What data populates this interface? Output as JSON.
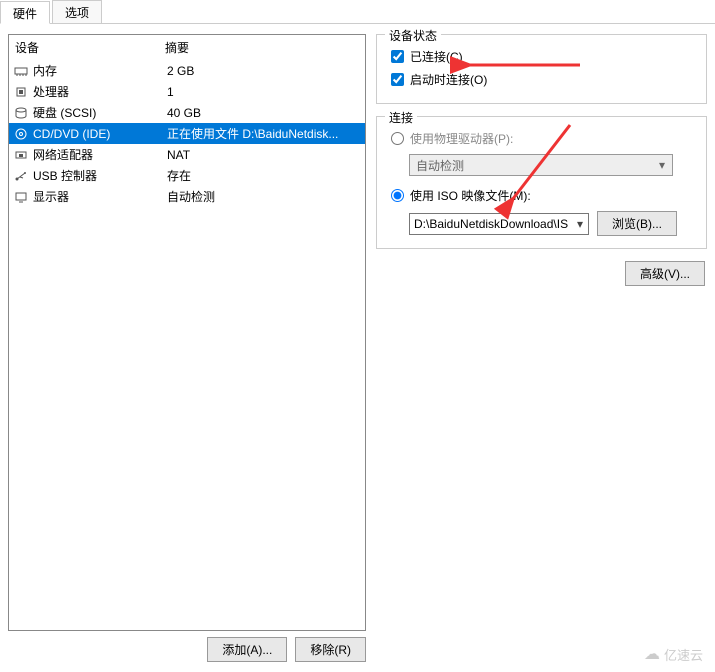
{
  "tabs": {
    "hardware": "硬件",
    "options": "选项"
  },
  "headers": {
    "device": "设备",
    "summary": "摘要"
  },
  "devices": [
    {
      "icon": "memory",
      "name": "内存",
      "summary": "2 GB",
      "selected": false
    },
    {
      "icon": "cpu",
      "name": "处理器",
      "summary": "1",
      "selected": false
    },
    {
      "icon": "disk",
      "name": "硬盘 (SCSI)",
      "summary": "40 GB",
      "selected": false
    },
    {
      "icon": "cd",
      "name": "CD/DVD (IDE)",
      "summary": "正在使用文件 D:\\BaiduNetdisk...",
      "selected": true
    },
    {
      "icon": "nic",
      "name": "网络适配器",
      "summary": "NAT",
      "selected": false
    },
    {
      "icon": "usb",
      "name": "USB 控制器",
      "summary": "存在",
      "selected": false
    },
    {
      "icon": "display",
      "name": "显示器",
      "summary": "自动检测",
      "selected": false
    }
  ],
  "buttons": {
    "add": "添加(A)...",
    "remove": "移除(R)",
    "advanced": "高级(V)...",
    "browse": "浏览(B)..."
  },
  "status_group": {
    "title": "设备状态",
    "connected": {
      "label": "已连接(C)",
      "checked": true
    },
    "connect_on_power": {
      "label": "启动时连接(O)",
      "checked": true
    }
  },
  "connection_group": {
    "title": "连接",
    "physical": {
      "label": "使用物理驱动器(P):",
      "checked": false,
      "dropdown": "自动检测"
    },
    "iso": {
      "label": "使用 ISO 映像文件(M):",
      "checked": true,
      "path": "D:\\BaiduNetdiskDownload\\IS"
    }
  },
  "watermark": "亿速云"
}
